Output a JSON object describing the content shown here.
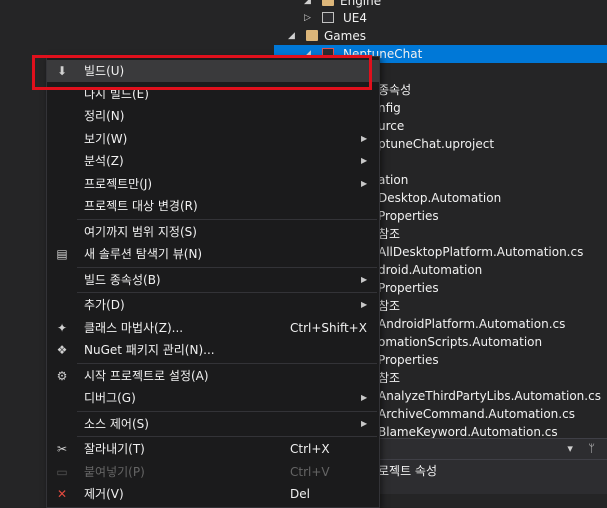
{
  "explorer": {
    "rows": [
      {
        "label": "Engine",
        "kind": "folder",
        "arrow": "◢"
      },
      {
        "label": "UE4",
        "kind": "project",
        "arrow": "▷"
      },
      {
        "label": "Games",
        "kind": "folder",
        "arrow": "◢"
      },
      {
        "label": "NeptuneChat",
        "kind": "project-red",
        "arrow": "◢"
      },
      {
        "label": "",
        "kind": "text",
        "arrow": ""
      },
      {
        "label": "종속성",
        "kind": "text",
        "arrow": ""
      },
      {
        "label": "nfig",
        "kind": "text",
        "arrow": ""
      },
      {
        "label": "urce",
        "kind": "text",
        "arrow": ""
      },
      {
        "label": "ptuneChat.uproject",
        "kind": "text",
        "arrow": ""
      },
      {
        "label": "",
        "kind": "text",
        "arrow": ""
      },
      {
        "label": "ation",
        "kind": "text",
        "arrow": ""
      },
      {
        "label": "Desktop.Automation",
        "kind": "text",
        "arrow": ""
      },
      {
        "label": "Properties",
        "kind": "text",
        "arrow": ""
      },
      {
        "label": "참조",
        "kind": "text",
        "arrow": ""
      },
      {
        "label": "AllDesktopPlatform.Automation.cs",
        "kind": "text",
        "arrow": ""
      },
      {
        "label": "droid.Automation",
        "kind": "text",
        "arrow": ""
      },
      {
        "label": "Properties",
        "kind": "text",
        "arrow": ""
      },
      {
        "label": "참조",
        "kind": "text",
        "arrow": ""
      },
      {
        "label": "AndroidPlatform.Automation.cs",
        "kind": "text",
        "arrow": ""
      },
      {
        "label": "omationScripts.Automation",
        "kind": "text",
        "arrow": ""
      },
      {
        "label": "Properties",
        "kind": "text",
        "arrow": ""
      },
      {
        "label": "참조",
        "kind": "text",
        "arrow": ""
      },
      {
        "label": "AnalyzeThirdPartyLibs.Automation.cs",
        "kind": "text",
        "arrow": ""
      },
      {
        "label": "ArchiveCommand.Automation.cs",
        "kind": "text",
        "arrow": ""
      },
      {
        "label": "BlameKeyword.Automation.cs",
        "kind": "text",
        "arrow": ""
      }
    ]
  },
  "properties_panel": {
    "tools": "▾ ᛘ",
    "title": "로젝트 속성"
  },
  "context_menu": {
    "items": [
      {
        "label": "빌드(U)",
        "icon": "build-icon",
        "glyph": "⬇",
        "shortcut": "",
        "submenu": false,
        "disabled": false
      },
      {
        "label": "다시 빌드(E)",
        "icon": "",
        "glyph": "",
        "shortcut": "",
        "submenu": false,
        "disabled": false
      },
      {
        "label": "정리(N)",
        "icon": "",
        "glyph": "",
        "shortcut": "",
        "submenu": false,
        "disabled": false
      },
      {
        "label": "보기(W)",
        "icon": "",
        "glyph": "",
        "shortcut": "",
        "submenu": true,
        "disabled": false
      },
      {
        "label": "분석(Z)",
        "icon": "",
        "glyph": "",
        "shortcut": "",
        "submenu": true,
        "disabled": false
      },
      {
        "label": "프로젝트만(J)",
        "icon": "",
        "glyph": "",
        "shortcut": "",
        "submenu": true,
        "disabled": false
      },
      {
        "label": "프로젝트 대상 변경(R)",
        "icon": "",
        "glyph": "",
        "shortcut": "",
        "submenu": false,
        "disabled": false
      },
      {
        "separator": true
      },
      {
        "label": "여기까지 범위 지정(S)",
        "icon": "",
        "glyph": "",
        "shortcut": "",
        "submenu": false,
        "disabled": false
      },
      {
        "label": "새 솔루션 탐색기 뷰(N)",
        "icon": "new-view-icon",
        "glyph": "▤",
        "shortcut": "",
        "submenu": false,
        "disabled": false
      },
      {
        "separator": true
      },
      {
        "label": "빌드 종속성(B)",
        "icon": "",
        "glyph": "",
        "shortcut": "",
        "submenu": true,
        "disabled": false
      },
      {
        "separator": true
      },
      {
        "label": "추가(D)",
        "icon": "",
        "glyph": "",
        "shortcut": "",
        "submenu": true,
        "disabled": false
      },
      {
        "label": "클래스 마법사(Z)...",
        "icon": "class-wizard-icon",
        "glyph": "✦",
        "shortcut": "Ctrl+Shift+X",
        "submenu": false,
        "disabled": false
      },
      {
        "label": "NuGet 패키지 관리(N)...",
        "icon": "nuget-icon",
        "glyph": "❖",
        "shortcut": "",
        "submenu": false,
        "disabled": false
      },
      {
        "separator": true
      },
      {
        "label": "시작 프로젝트로 설정(A)",
        "icon": "gear-icon",
        "glyph": "⚙",
        "shortcut": "",
        "submenu": false,
        "disabled": false
      },
      {
        "label": "디버그(G)",
        "icon": "",
        "glyph": "",
        "shortcut": "",
        "submenu": true,
        "disabled": false
      },
      {
        "separator": true
      },
      {
        "label": "소스 제어(S)",
        "icon": "",
        "glyph": "",
        "shortcut": "",
        "submenu": true,
        "disabled": false
      },
      {
        "separator": true
      },
      {
        "label": "잘라내기(T)",
        "icon": "scissors-icon",
        "glyph": "✂",
        "shortcut": "Ctrl+X",
        "submenu": false,
        "disabled": false
      },
      {
        "label": "붙여넣기(P)",
        "icon": "paste-icon",
        "glyph": "▭",
        "shortcut": "Ctrl+V",
        "submenu": false,
        "disabled": true
      },
      {
        "label": "제거(V)",
        "icon": "remove-icon",
        "glyph": "✕",
        "shortcut": "Del",
        "submenu": false,
        "disabled": false
      }
    ]
  },
  "colors": {
    "accent": "#0078d7",
    "highlight": "#e0101c",
    "remove": "#e04a3f"
  }
}
